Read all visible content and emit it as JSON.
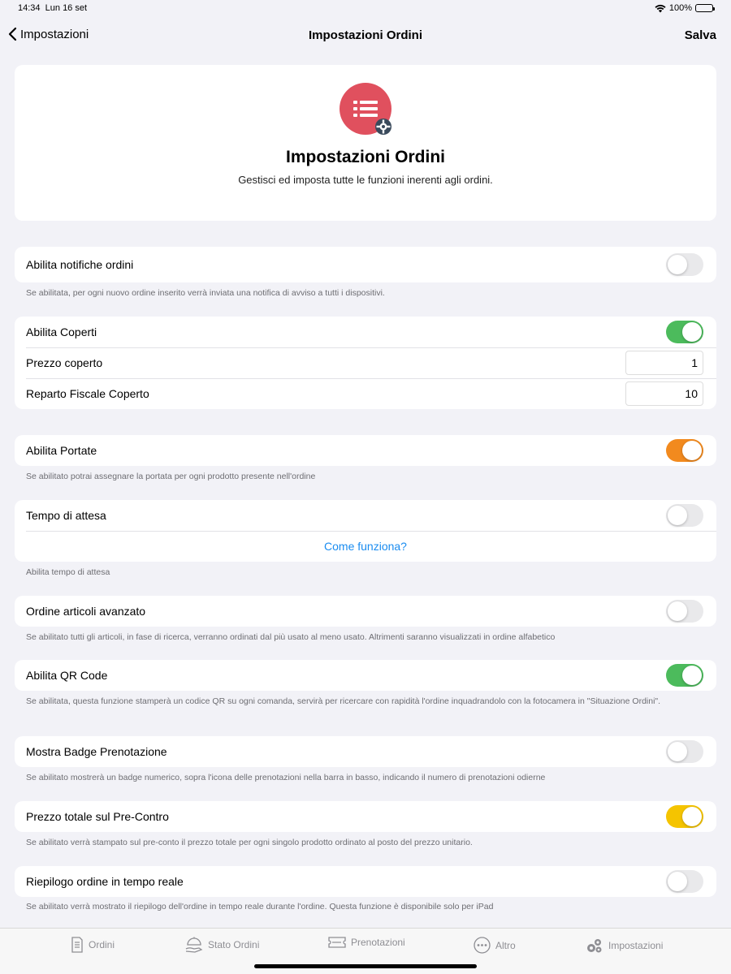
{
  "status": {
    "time": "14:34",
    "date": "Lun 16 set",
    "battery": "100%"
  },
  "nav": {
    "back_label": "Impostazioni",
    "title": "Impostazioni Ordini",
    "save_label": "Salva"
  },
  "header": {
    "title": "Impostazioni Ordini",
    "subtitle": "Gestisci ed imposta tutte le funzioni inerenti agli ordini.",
    "icon": "orders-list-gear-icon",
    "icon_color": "#e0505e"
  },
  "settings": {
    "notifiche": {
      "label": "Abilita notifiche ordini",
      "enabled": false,
      "footnote": "Se abilitata, per ogni nuovo ordine inserito verrà inviata una notifica di avviso a tutti i dispositivi."
    },
    "coperti": {
      "label": "Abilita Coperti",
      "enabled": true,
      "prezzo_label": "Prezzo coperto",
      "prezzo_value": "1",
      "reparto_label": "Reparto Fiscale Coperto",
      "reparto_value": "10"
    },
    "portate": {
      "label": "Abilita Portate",
      "enabled": true,
      "footnote": "Se abilitato potrai assegnare la portata per ogni prodotto presente nell'ordine"
    },
    "attesa": {
      "label": "Tempo di attesa",
      "enabled": false,
      "link": "Come funziona?",
      "footnote": "Abilita tempo di attesa"
    },
    "ordine_avanzato": {
      "label": "Ordine articoli avanzato",
      "enabled": false,
      "footnote": "Se abilitato tutti gli articoli, in fase di ricerca, verranno ordinati dal più usato al meno usato. Altrimenti saranno visualizzati in ordine alfabetico"
    },
    "qr": {
      "label": "Abilita QR Code",
      "enabled": true,
      "footnote": "Se abilitata, questa funzione stamperà un codice QR su ogni comanda, servirà per ricercare con rapidità l'ordine inquadrandolo con la fotocamera in \"Situazione Ordini\"."
    },
    "badge": {
      "label": "Mostra Badge Prenotazione",
      "enabled": false,
      "footnote": "Se abilitato mostrerà un badge numerico, sopra l'icona delle prenotazioni nella barra in basso, indicando il numero di prenotazioni odierne"
    },
    "precontro": {
      "label": "Prezzo totale sul Pre-Contro",
      "enabled": true,
      "footnote": "Se abilitato verrà stampato sul pre-conto il prezzo totale per ogni singolo prodotto ordinato al posto del prezzo unitario."
    },
    "riepilogo": {
      "label": "Riepilogo ordine in tempo reale",
      "enabled": false,
      "footnote": "Se abilitato verrà mostrato il riepilogo dell'ordine in tempo reale durante l'ordine. Questa funzione è disponibile solo per iPad"
    }
  },
  "colors": {
    "toggle_green": "#4cbb5c",
    "toggle_orange": "#f28a1e",
    "toggle_yellow": "#f5c400",
    "toggle_off": "#e9e9eb",
    "link_blue": "#1a8cf0"
  },
  "tabs": [
    {
      "label": "Ordini",
      "icon": "document-icon"
    },
    {
      "label": "Stato Ordini",
      "icon": "serving-hand-icon"
    },
    {
      "label": "Prenotazioni",
      "icon": "ticket-icon"
    },
    {
      "label": "Altro",
      "icon": "more-icon"
    },
    {
      "label": "Impostazioni",
      "icon": "gears-icon"
    }
  ]
}
